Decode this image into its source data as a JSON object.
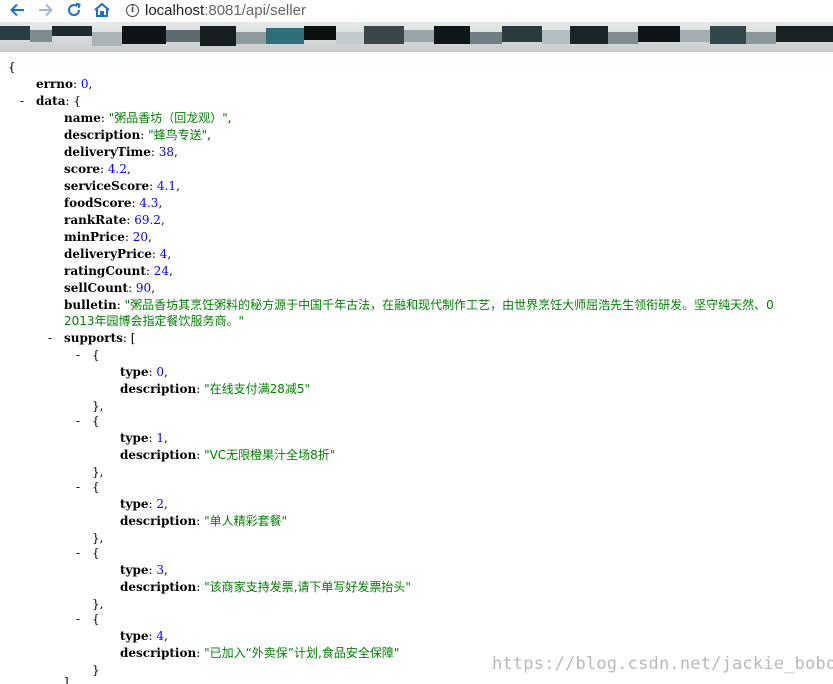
{
  "browser": {
    "url_host": "localhost",
    "url_rest": ":8081/api/seller",
    "back_icon": "arrow-left-icon",
    "forward_icon": "arrow-right-icon",
    "reload_icon": "reload-icon",
    "home_icon": "home-icon",
    "info_icon": "info-icon",
    "info_glyph": "i"
  },
  "json": {
    "open_brace": "{",
    "errno_key": "errno",
    "errno_val": "0",
    "data_toggle": "-",
    "data_key": "data",
    "data_open": "{",
    "fields": [
      {
        "key": "name",
        "val": "\"粥品香坊（回龙观）\"",
        "type": "s"
      },
      {
        "key": "description",
        "val": "\"蜂鸟专送\"",
        "type": "s"
      },
      {
        "key": "deliveryTime",
        "val": "38",
        "type": "n"
      },
      {
        "key": "score",
        "val": "4.2",
        "type": "n"
      },
      {
        "key": "serviceScore",
        "val": "4.1",
        "type": "n"
      },
      {
        "key": "foodScore",
        "val": "4.3",
        "type": "n"
      },
      {
        "key": "rankRate",
        "val": "69.2",
        "type": "n"
      },
      {
        "key": "minPrice",
        "val": "20",
        "type": "n"
      },
      {
        "key": "deliveryPrice",
        "val": "4",
        "type": "n"
      },
      {
        "key": "ratingCount",
        "val": "24",
        "type": "n"
      },
      {
        "key": "sellCount",
        "val": "90",
        "type": "n"
      }
    ],
    "bulletin_key": "bulletin",
    "bulletin_line1": "\"粥品香坊其烹饪粥料的秘方源于中国千年古法，在融和现代制作工艺，由世界烹饪大师屈浩先生领衔研发。坚守纯天然、0",
    "bulletin_line2": "2013年园博会指定餐饮服务商。\"",
    "supports_toggle": "-",
    "supports_key": "supports",
    "supports_open": "[",
    "supports": [
      {
        "type": "0",
        "description": "\"在线支付满28减5\""
      },
      {
        "type": "1",
        "description": "\"VC无限橙果汁全场8折\""
      },
      {
        "type": "2",
        "description": "\"单人精彩套餐\""
      },
      {
        "type": "3",
        "description": "\"该商家支持发票,请下单写好发票抬头\""
      },
      {
        "type": "4",
        "description": "\"已加入“外卖保”计划,食品安全保障\""
      }
    ],
    "item_toggle": "-",
    "item_open": "{",
    "item_close": "},",
    "item_close_last": "}",
    "type_key": "type",
    "desc_key": "description",
    "array_close": "]"
  },
  "watermark": "https://blog.csdn.net/jackie_bobo",
  "colors": {
    "key": "#000000",
    "number": "#0000ff",
    "string": "#008000",
    "nav_icon": "#1a73c8"
  }
}
